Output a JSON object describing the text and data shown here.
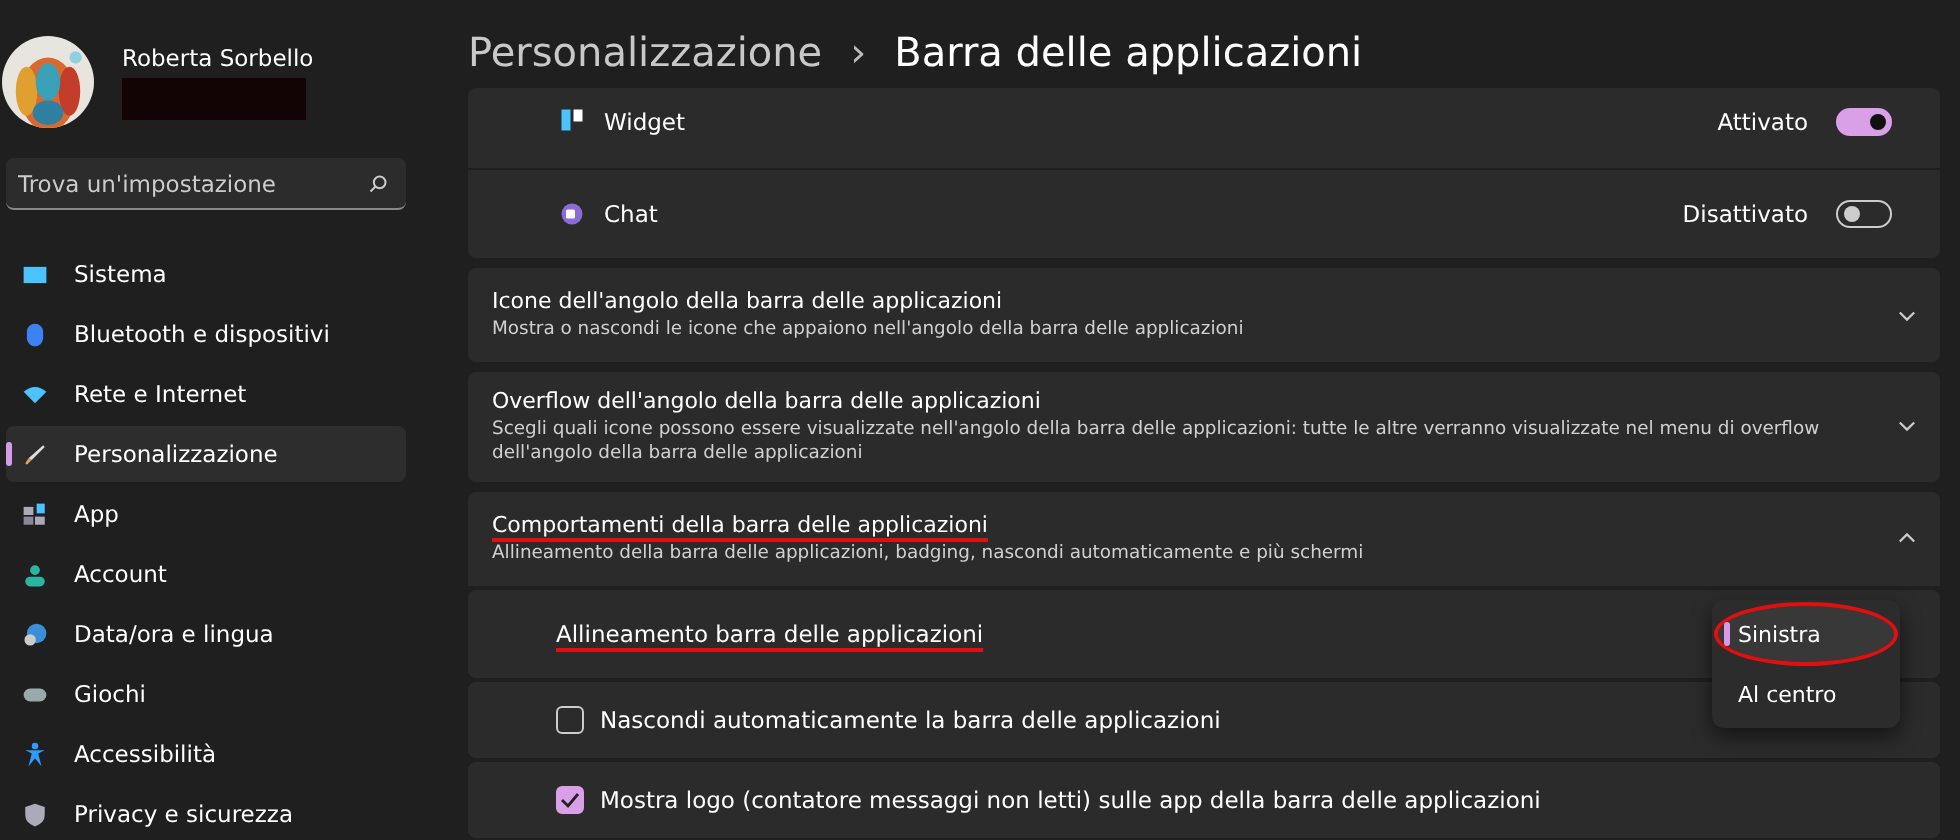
{
  "user": {
    "name": "Roberta Sorbello",
    "redacted": true
  },
  "search": {
    "placeholder": "Trova un'impostazione"
  },
  "sidebar": {
    "items": [
      {
        "label": "Sistema",
        "selected": false
      },
      {
        "label": "Bluetooth e dispositivi",
        "selected": false
      },
      {
        "label": "Rete e Internet",
        "selected": false
      },
      {
        "label": "Personalizzazione",
        "selected": true
      },
      {
        "label": "App",
        "selected": false
      },
      {
        "label": "Account",
        "selected": false
      },
      {
        "label": "Data/ora e lingua",
        "selected": false
      },
      {
        "label": "Giochi",
        "selected": false
      },
      {
        "label": "Accessibilità",
        "selected": false
      },
      {
        "label": "Privacy e sicurezza",
        "selected": false
      }
    ]
  },
  "breadcrumb": {
    "parent": "Personalizzazione",
    "separator": "›",
    "current": "Barra delle applicazioni"
  },
  "taskbar_items": [
    {
      "label": "Widget",
      "state": "Attivato",
      "on": true
    },
    {
      "label": "Chat",
      "state": "Disattivato",
      "on": false
    }
  ],
  "sections": [
    {
      "title": "Icone dell'angolo della barra delle applicazioni",
      "description": "Mostra o nascondi le icone che appaiono nell'angolo della barra delle applicazioni",
      "expanded": false,
      "underlined": false
    },
    {
      "title": "Overflow dell'angolo della barra delle applicazioni",
      "description": "Scegli quali icone possono essere visualizzate nell'angolo della barra delle applicazioni: tutte le altre verranno visualizzate nel menu di overflow dell'angolo della barra delle applicazioni",
      "expanded": false,
      "underlined": false
    },
    {
      "title": "Comportamenti della barra delle applicazioni",
      "description": "Allineamento della barra delle applicazioni, badging, nascondi automaticamente e più schermi",
      "expanded": true,
      "underlined": true
    }
  ],
  "behaviors": [
    {
      "kind": "dropdown",
      "label": "Allineamento barra delle applicazioni",
      "underlined": true
    },
    {
      "kind": "checkbox",
      "label": "Nascondi automaticamente la barra delle applicazioni",
      "checked": false
    },
    {
      "kind": "checkbox",
      "label": "Mostra logo (contatore messaggi non letti) sulle app della barra delle applicazioni",
      "checked": true
    }
  ],
  "dropdown": {
    "options": [
      {
        "label": "Sinistra",
        "selected": true,
        "circled": true
      },
      {
        "label": "Al centro",
        "selected": false,
        "circled": false
      }
    ]
  }
}
